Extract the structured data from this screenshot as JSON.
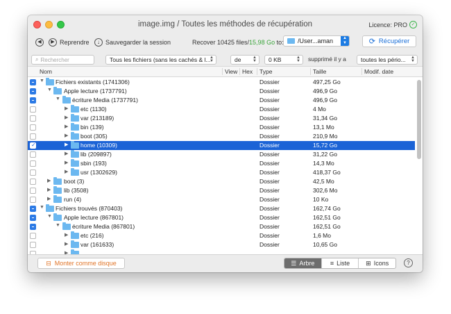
{
  "window": {
    "title": "image.img / Toutes les méthodes de récupération",
    "licence": "Licence: PRO"
  },
  "toolbar": {
    "back_icon": "chevron-left-icon",
    "resume_label": "Reprendre",
    "save_label": "Sauvegarder la session",
    "recover_prefix": "Recover 10425 files/",
    "recover_size": "15,98 Go",
    "recover_suffix": " to:",
    "path_value": "/User...aman",
    "recover_button": "Récupérer",
    "recover_size_color": "#3aa53a"
  },
  "filters": {
    "search_placeholder": "Rechercher",
    "file_filter": "Tous les fichiers (sans les cachés & l...",
    "size_op": "de",
    "size_value": "0 KB",
    "deleted_label": "supprimé il y a",
    "period": "toutes les pério..."
  },
  "columns": {
    "name": "Nom",
    "view": "View",
    "hex": "Hex",
    "type": "Type",
    "size": "Taille",
    "modified": "Modif. date"
  },
  "rows": [
    {
      "name": "Fichiers existants (1741306)",
      "type": "Dossier",
      "size": "497,25 Go"
    },
    {
      "name": "Apple lecture (1737791)",
      "type": "Dossier",
      "size": "496,9 Go"
    },
    {
      "name": "écriture Media (1737791)",
      "type": "Dossier",
      "size": "496,9 Go"
    },
    {
      "name": "etc (1130)",
      "type": "Dossier",
      "size": "4 Mo"
    },
    {
      "name": "var (213189)",
      "type": "Dossier",
      "size": "31,34 Go"
    },
    {
      "name": "bin (139)",
      "type": "Dossier",
      "size": "13,1 Mo"
    },
    {
      "name": "boot (305)",
      "type": "Dossier",
      "size": "210,9 Mo"
    },
    {
      "name": "home (10309)",
      "type": "Dossier",
      "size": "15,72 Go"
    },
    {
      "name": "lib (209897)",
      "type": "Dossier",
      "size": "31,22 Go"
    },
    {
      "name": "sbin (193)",
      "type": "Dossier",
      "size": "14,3 Mo"
    },
    {
      "name": "usr (1302629)",
      "type": "Dossier",
      "size": "418,37 Go"
    },
    {
      "name": "boot (3)",
      "type": "Dossier",
      "size": "42,5 Mo"
    },
    {
      "name": "lib (3508)",
      "type": "Dossier",
      "size": "302,6 Mo"
    },
    {
      "name": "run (4)",
      "type": "Dossier",
      "size": "10 Ko"
    },
    {
      "name": "Fichiers trouvés (870403)",
      "type": "Dossier",
      "size": "162,74 Go"
    },
    {
      "name": "Apple lecture (867801)",
      "type": "Dossier",
      "size": "162,51 Go"
    },
    {
      "name": "écriture Media (867801)",
      "type": "Dossier",
      "size": "162,51 Go"
    },
    {
      "name": "etc (216)",
      "type": "Dossier",
      "size": "1,6 Mo"
    },
    {
      "name": "var (161633)",
      "type": "Dossier",
      "size": "10,65 Go"
    }
  ],
  "bottom": {
    "mount_label": "Monter comme disque",
    "view_tree": "Arbre",
    "view_list": "Liste",
    "view_icons": "Icons",
    "help": "?"
  }
}
